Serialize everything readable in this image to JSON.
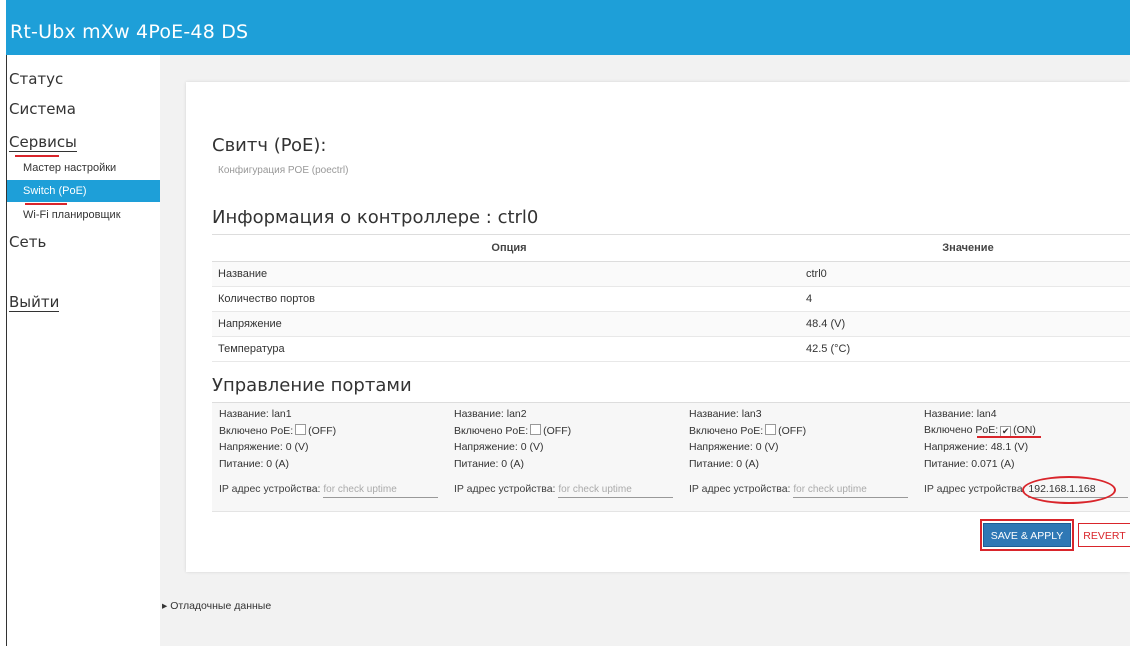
{
  "header": {
    "title": "Rt-Ubx mXw 4PoE-48 DS"
  },
  "sidebar": {
    "items": [
      {
        "label": "Статус"
      },
      {
        "label": "Система"
      },
      {
        "label": "Сервисы"
      },
      {
        "label": "Сеть"
      },
      {
        "label": "Выйти"
      }
    ],
    "sub_items": [
      {
        "label": "Мастер настройки"
      },
      {
        "label": "Switch (PoE)"
      },
      {
        "label": "Wi-Fi планировщик"
      }
    ]
  },
  "page": {
    "title": "Свитч (PoE):",
    "description": "Конфигурация POE (poectrl)"
  },
  "controller": {
    "heading": "Информация о контроллере : ctrl0",
    "columns": [
      "Опция",
      "Значение"
    ],
    "rows": [
      {
        "option": "Название",
        "value": "ctrl0"
      },
      {
        "option": "Количество портов",
        "value": "4"
      },
      {
        "option": "Напряжение",
        "value": "48.4 (V)"
      },
      {
        "option": "Температура",
        "value": "42.5 (°C)"
      }
    ]
  },
  "ports": {
    "heading": "Управление портами",
    "items": [
      {
        "name": "Название: lan1",
        "poe_label": "Включено PoE:",
        "checked": false,
        "state": "(OFF)",
        "voltage": "Напряжение: 0 (V)",
        "power": "Питание: 0 (A)",
        "ip_label": "IP адрес устройства:",
        "ip_value": "",
        "ip_placeholder": "for check uptime"
      },
      {
        "name": "Название: lan2",
        "poe_label": "Включено PoE:",
        "checked": false,
        "state": "(OFF)",
        "voltage": "Напряжение: 0 (V)",
        "power": "Питание: 0 (A)",
        "ip_label": "IP адрес устройства:",
        "ip_value": "",
        "ip_placeholder": "for check uptime"
      },
      {
        "name": "Название: lan3",
        "poe_label": "Включено PoE:",
        "checked": false,
        "state": "(OFF)",
        "voltage": "Напряжение: 0 (V)",
        "power": "Питание: 0 (A)",
        "ip_label": "IP адрес устройства:",
        "ip_value": "",
        "ip_placeholder": "for check uptime"
      },
      {
        "name": "Название: lan4",
        "poe_label": "Включено PoE:",
        "checked": true,
        "state": "(ON)",
        "voltage": "Напряжение: 48.1 (V)",
        "power": "Питание: 0.071 (A)",
        "ip_label": "IP адрес устройства:",
        "ip_value": "192.168.1.168",
        "ip_placeholder": ""
      }
    ]
  },
  "buttons": {
    "save_apply": "SAVE & APPLY",
    "revert": "REVERT"
  },
  "debug": {
    "label": "Отладочные данные"
  },
  "colors": {
    "header": "#1e9fd8",
    "active": "#1e9fd8",
    "save": "#2f78b5",
    "annotation": "#d9252b"
  }
}
